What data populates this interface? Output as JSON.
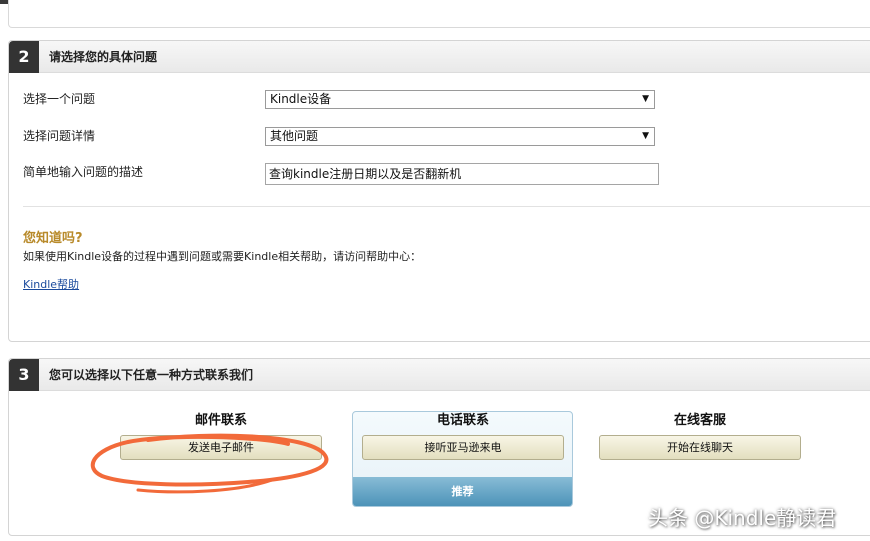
{
  "section2": {
    "number": "2",
    "title": "请选择您的具体问题",
    "field1": {
      "label": "选择一个问题",
      "value": "Kindle设备"
    },
    "field2": {
      "label": "选择问题详情",
      "value": "其他问题"
    },
    "field3": {
      "label": "简单地输入问题的描述",
      "value": "查询kindle注册日期以及是否翻新机"
    },
    "didyou_title": "您知道吗?",
    "didyou_text": "如果使用Kindle设备的过程中遇到问题或需要Kindle相关帮助，请访问帮助中心：",
    "help_link": "Kindle帮助"
  },
  "section3": {
    "number": "3",
    "title": "您可以选择以下任意一种方式联系我们",
    "email": {
      "heading": "邮件联系",
      "button": "发送电子邮件"
    },
    "phone": {
      "heading": "电话联系",
      "button": "接听亚马逊来电",
      "badge": "推荐"
    },
    "chat": {
      "heading": "在线客服",
      "button": "开始在线聊天"
    }
  },
  "watermark": "头条 @Kindle静读君",
  "colors": {
    "annotation": "#f26a3a",
    "didyou": "#b88a2a",
    "link": "#1a4a9c",
    "recommend": "#4d93b8"
  }
}
